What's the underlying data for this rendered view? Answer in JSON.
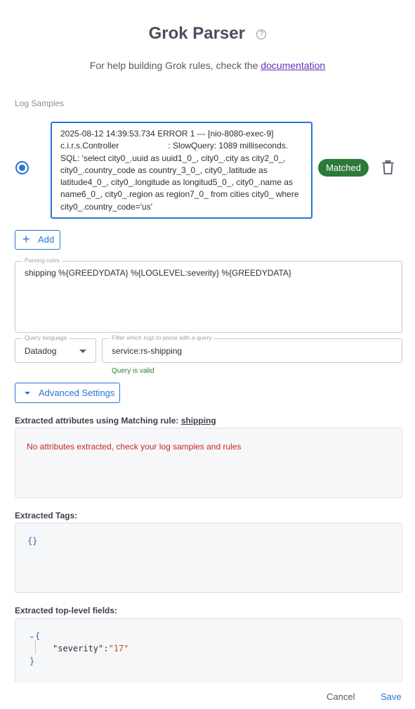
{
  "header": {
    "title": "Grok Parser",
    "help_icon": "question-circle-icon",
    "help_text_prefix": "For help building Grok rules, check the ",
    "help_link": "documentation"
  },
  "log_samples": {
    "label": "Log Samples",
    "sample_text": "2025-08-12 14:39:53.734 ERROR 1 --- [nio-8080-exec-9]\nc.i.r.s.Controller                     : SlowQuery: 1089 milliseconds.\nSQL: 'select city0_.uuid as uuid1_0_, city0_.city as city2_0_,\ncity0_.country_code as country_3_0_, city0_.latitude as\nlatitude4_0_, city0_.longitude as longitud5_0_, city0_.name as\nname6_0_, city0_.region as region7_0_ from cities city0_ where\ncity0_.country_code='us'",
    "status_badge": "Matched",
    "delete_icon": "trash-icon",
    "add_label": "Add"
  },
  "parsing_rules": {
    "legend": "Parsing rules",
    "value": "shipping %{GREEDYDATA} %{LOGLEVEL:severity} %{GREEDYDATA}"
  },
  "query_language": {
    "legend": "Query language",
    "value": "Datadog"
  },
  "query_filter": {
    "legend": "Filter which logs to parse with a query",
    "value": "service:rs-shipping",
    "validation": "Query is valid"
  },
  "advanced_settings_label": "Advanced Settings",
  "extracted_attributes": {
    "heading_prefix": "Extracted attributes using Matching rule: ",
    "rule_name": "shipping",
    "message": "No attributes extracted, check your log samples and rules"
  },
  "extracted_tags": {
    "heading": "Extracted Tags:",
    "code": "{}"
  },
  "extracted_fields": {
    "heading": "Extracted top-level fields:",
    "open_brace": "{",
    "close_brace": "}",
    "key": "\"severity\"",
    "colon": ":",
    "value": "\"17\""
  },
  "footer": {
    "cancel_label": "Cancel",
    "save_label": "Save"
  },
  "colors": {
    "accent": "#2a74d6",
    "success": "#2c7a38",
    "error": "#c62828"
  }
}
